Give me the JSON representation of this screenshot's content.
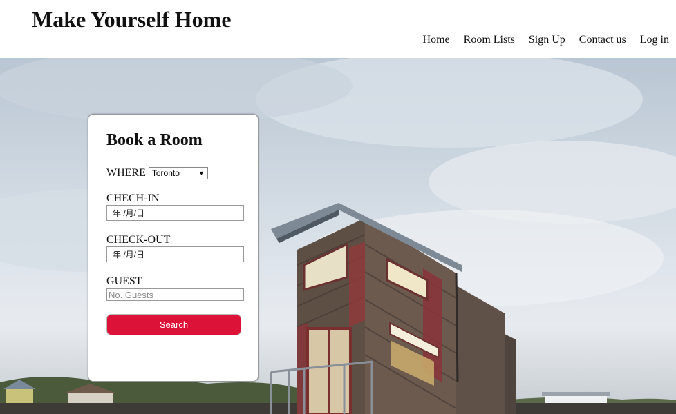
{
  "header": {
    "title": "Make Yourself Home",
    "nav": [
      "Home",
      "Room Lists",
      "Sign Up",
      "Contact us",
      "Log in"
    ]
  },
  "booking": {
    "title": "Book a Room",
    "where_label": "WHERE",
    "where_value": "Toronto",
    "checkin_label": "CHECH-IN",
    "checkin_value": "年 /月/日",
    "checkout_label": "CHECK-OUT",
    "checkout_value": "年 /月/日",
    "guest_label": "GUEST",
    "guest_placeholder": "No. Guests",
    "search_label": "Search"
  },
  "colors": {
    "accent": "#dc1238"
  },
  "icons": {
    "select_arrow": "dropdown-arrow-icon"
  }
}
